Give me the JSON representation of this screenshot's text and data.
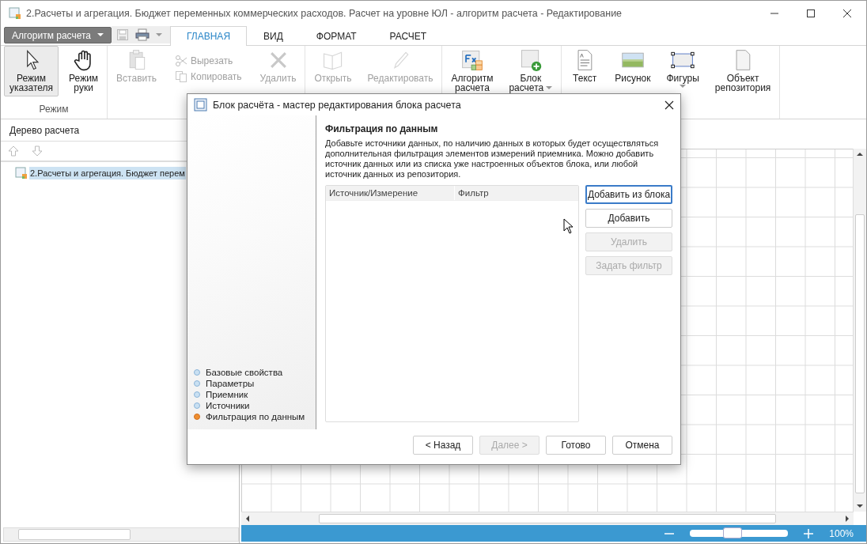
{
  "window": {
    "title": "2.Расчеты и агрегация. Бюджет переменных коммерческих расходов. Расчет на уровне ЮЛ  - алгоритм расчета - Редактирование"
  },
  "app_menu": {
    "label": "Алгоритм расчета"
  },
  "tabs": [
    {
      "label": "ГЛАВНАЯ",
      "selected": true
    },
    {
      "label": "ВИД",
      "selected": false
    },
    {
      "label": "ФОРМАТ",
      "selected": false
    },
    {
      "label": "РАСЧЕТ",
      "selected": false
    }
  ],
  "ribbon": {
    "groups": [
      {
        "label": "Режим",
        "items": [
          {
            "kind": "large",
            "lines": [
              "Режим",
              "указателя"
            ],
            "pressed": true,
            "disabled": false,
            "dropdown": false
          },
          {
            "kind": "large",
            "lines": [
              "Режим",
              "руки"
            ],
            "pressed": false,
            "disabled": false,
            "dropdown": false
          }
        ]
      },
      {
        "items": [
          {
            "kind": "large",
            "lines": [
              "Вставить"
            ],
            "pressed": false,
            "disabled": true,
            "dropdown": false
          },
          {
            "kind": "stack",
            "items": [
              {
                "label": "Вырезать",
                "disabled": true
              },
              {
                "label": "Копировать",
                "disabled": true
              }
            ]
          },
          {
            "kind": "large",
            "lines": [
              "Удалить"
            ],
            "pressed": false,
            "disabled": true,
            "dropdown": false
          }
        ]
      },
      {
        "items": [
          {
            "kind": "large",
            "lines": [
              "Открыть"
            ],
            "pressed": false,
            "disabled": true,
            "dropdown": false
          },
          {
            "kind": "large",
            "lines": [
              "Редактировать"
            ],
            "pressed": false,
            "disabled": true,
            "dropdown": false
          }
        ]
      },
      {
        "items": [
          {
            "kind": "large",
            "lines": [
              "Алгоритм",
              "расчета"
            ],
            "pressed": false,
            "disabled": false,
            "dropdown": false
          },
          {
            "kind": "large",
            "lines": [
              "Блок",
              "расчета"
            ],
            "pressed": false,
            "disabled": false,
            "dropdown": true
          }
        ]
      },
      {
        "items": [
          {
            "kind": "large",
            "lines": [
              "Текст"
            ],
            "pressed": false,
            "disabled": false,
            "dropdown": false
          },
          {
            "kind": "large",
            "lines": [
              "Рисунок"
            ],
            "pressed": false,
            "disabled": false,
            "dropdown": false
          },
          {
            "kind": "large",
            "lines": [
              "Фигуры"
            ],
            "pressed": false,
            "disabled": false,
            "dropdown": true
          },
          {
            "kind": "large",
            "lines": [
              "Объект",
              "репозитория"
            ],
            "pressed": false,
            "disabled": false,
            "dropdown": false
          }
        ]
      }
    ]
  },
  "tree_panel": {
    "title": "Дерево расчета",
    "items": [
      {
        "label": "2.Расчеты и агрегация. Бюджет перем",
        "selected": true
      }
    ]
  },
  "status_bar": {
    "zoom": {
      "level": 0.44,
      "reading": "100%"
    }
  },
  "dialog": {
    "title": "Блок расчёта - мастер редактирования блока расчета",
    "steps": [
      {
        "label": "Базовые свойства",
        "selected": false
      },
      {
        "label": "Параметры",
        "selected": false
      },
      {
        "label": "Приемник",
        "selected": false
      },
      {
        "label": "Источники",
        "selected": false
      },
      {
        "label": "Фильтрация по данным",
        "selected": true
      }
    ],
    "heading": "Фильтрация по данным",
    "description": "Добавьте источники данных, по наличию данных в которых будет осуществляться дополнительная фильтрация элементов измерений приемника. Можно добавить источник данных или из списка уже настроенных объектов блока, или любой источник данных из репозитория.",
    "table": {
      "columns": [
        "Источник/Измерение",
        "Фильтр"
      ]
    },
    "side_buttons": [
      {
        "label": "Добавить из блока",
        "disabled": false,
        "focused": true
      },
      {
        "label": "Добавить",
        "disabled": false,
        "focused": false
      },
      {
        "label": "Удалить",
        "disabled": true,
        "focused": false
      },
      {
        "label": "Задать фильтр",
        "disabled": true,
        "focused": false
      }
    ],
    "footer_buttons": [
      {
        "label": "< Назад",
        "disabled": false
      },
      {
        "label": "Далее >",
        "disabled": true
      },
      {
        "label": "Готово",
        "disabled": false
      },
      {
        "label": "Отмена",
        "disabled": false
      }
    ]
  }
}
